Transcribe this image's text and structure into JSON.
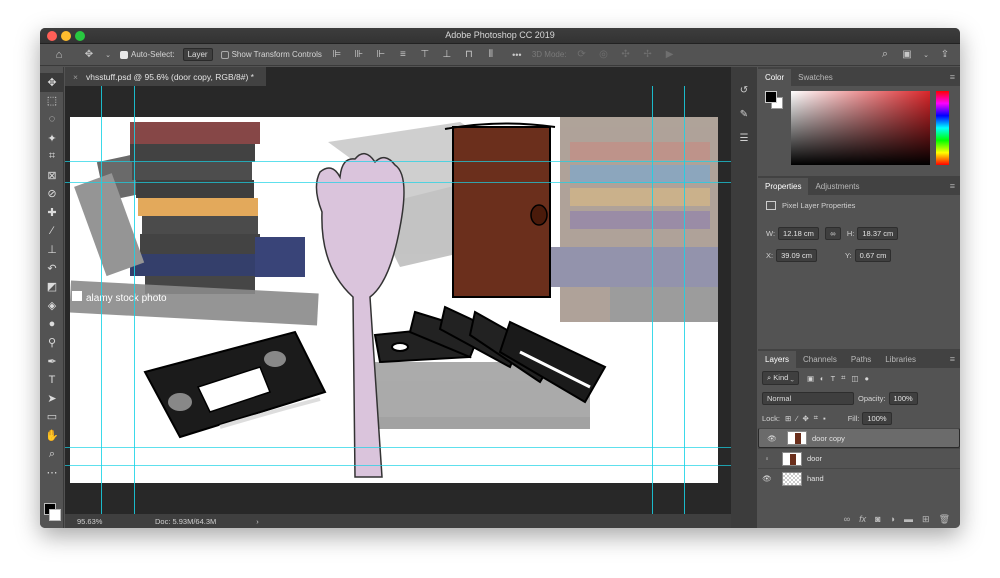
{
  "window": {
    "title": "Adobe Photoshop CC 2019"
  },
  "options_bar": {
    "home_icon": "home-icon",
    "move_icon": "move-tool-icon",
    "auto_select_label": "Auto-Select:",
    "auto_select_value": "Layer",
    "transform_controls_label": "Show Transform Controls",
    "mode_3d_label": "3D Mode:",
    "more": "•••"
  },
  "document": {
    "tab_title": "vhsstuff.psd @ 95.6% (door copy, RGB/8#) *",
    "zoom": "95.63%",
    "doc_size": "Doc: 5.93M/64.3M",
    "status_arrow": "›",
    "watermark": "alamy stock photo"
  },
  "color_panel": {
    "tabs": [
      "Color",
      "Swatches"
    ],
    "foreground": "#000000",
    "background": "#ffffff",
    "hue_color": "#d9262a"
  },
  "properties_panel": {
    "tabs": [
      "Properties",
      "Adjustments"
    ],
    "heading": "Pixel Layer Properties",
    "w_label": "W:",
    "w_value": "12.18 cm",
    "h_label": "H:",
    "h_value": "18.37 cm",
    "x_label": "X:",
    "x_value": "39.09 cm",
    "y_label": "Y:",
    "y_value": "0.67 cm"
  },
  "layers_panel": {
    "tabs": [
      "Layers",
      "Channels",
      "Paths",
      "Libraries"
    ],
    "kind_label": "Kind",
    "blend_mode": "Normal",
    "opacity_label": "Opacity:",
    "opacity_value": "100%",
    "lock_label": "Lock:",
    "fill_label": "Fill:",
    "fill_value": "100%",
    "layers": [
      {
        "name": "door copy",
        "visible": true,
        "selected": true
      },
      {
        "name": "door",
        "visible": false,
        "selected": false
      },
      {
        "name": "hand",
        "visible": true,
        "selected": false
      }
    ]
  },
  "colors": {
    "door": "#6b2f1c",
    "hand": "#dac4dc",
    "guide": "#19d3e6"
  }
}
